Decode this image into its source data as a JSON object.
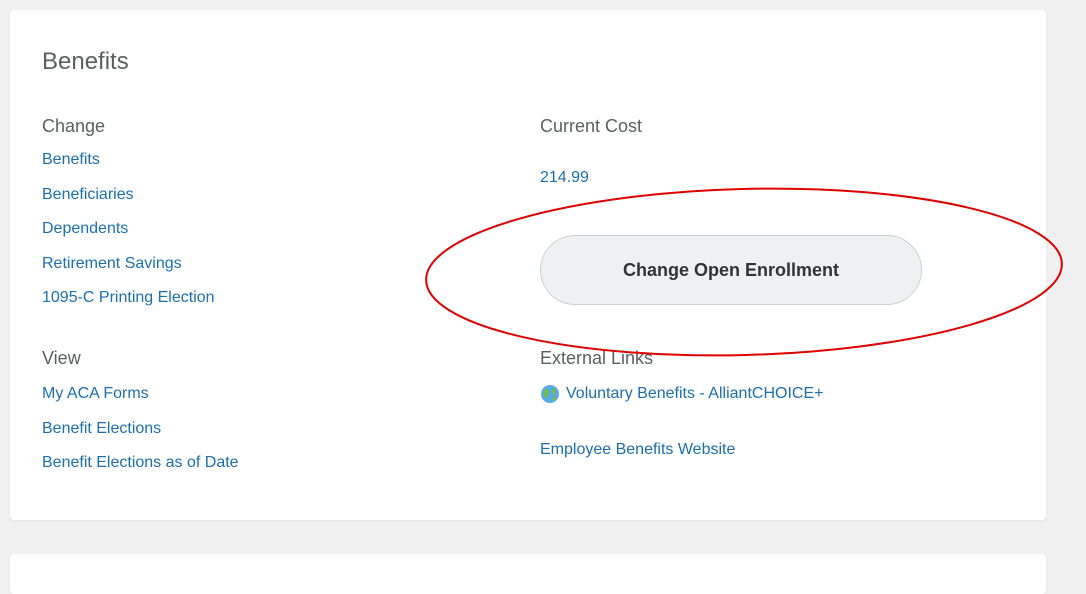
{
  "card": {
    "title": "Benefits"
  },
  "change": {
    "heading": "Change",
    "links": [
      "Benefits",
      "Beneficiaries",
      "Dependents",
      "Retirement Savings",
      "1095-C Printing Election"
    ]
  },
  "view": {
    "heading": "View",
    "links": [
      "My ACA Forms",
      "Benefit Elections",
      "Benefit Elections as of Date"
    ]
  },
  "current_cost": {
    "heading": "Current Cost",
    "value": "214.99"
  },
  "enrollment": {
    "button_label": "Change Open Enrollment"
  },
  "external_links": {
    "heading": "External Links",
    "voluntary_benefits": "Voluntary Benefits - AlliantCHOICE+",
    "voluntary_icon": "globe-icon",
    "employee_benefits": "Employee Benefits Website"
  },
  "colors": {
    "link": "#1b6fae",
    "heading": "#5b5f62",
    "annotation": "#e00000",
    "button_bg": "#eef0f2"
  }
}
